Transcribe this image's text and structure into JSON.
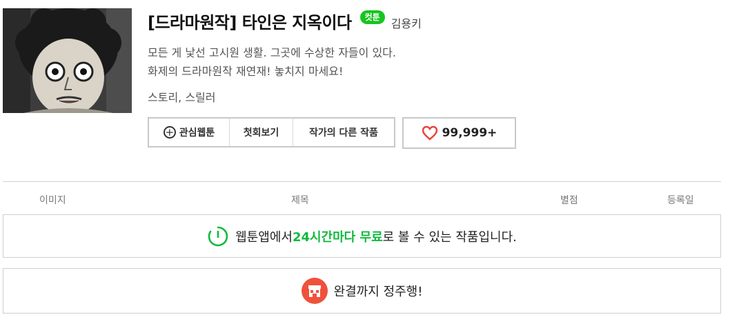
{
  "title": "[드라마원작] 타인은 지옥이다",
  "badge": "컷툰",
  "author": "김용키",
  "description_line1": "모든 게 낯선 고시원 생활. 그곳에 수상한 자들이 있다.",
  "description_line2": "화제의 드라마원작 재연재! 놓치지 마세요!",
  "genre": "스토리, 스릴러",
  "buttons": {
    "favorite": "관심웹툰",
    "first_episode": "첫회보기",
    "other_works": "작가의 다른 작품"
  },
  "like_count": "99,999+",
  "table_headers": {
    "image": "이미지",
    "title": "제목",
    "rating": "별점",
    "date": "등록일"
  },
  "notice1": {
    "before": "웹툰앱에서 ",
    "highlight": "24시간마다 무료",
    "after": "로 볼 수 있는 작품입니다."
  },
  "notice2": "완결까지 정주행!",
  "colors": {
    "badge_green": "#16c51f",
    "highlight_green": "#11b93d",
    "heart_red": "#e8433b",
    "shop_orange": "#f0513a"
  },
  "icons": [
    "plus-circle-icon",
    "heart-icon",
    "timer-icon",
    "shop-icon"
  ]
}
